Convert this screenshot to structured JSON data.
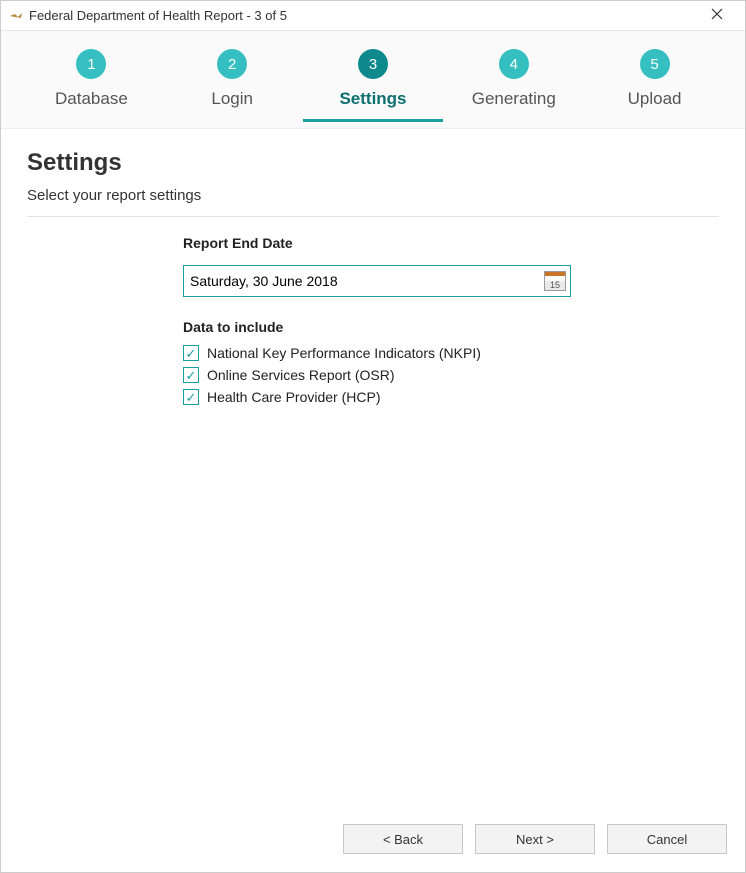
{
  "titlebar": {
    "text": "Federal Department of Health Report - 3 of 5"
  },
  "steps": [
    {
      "num": "1",
      "label": "Database"
    },
    {
      "num": "2",
      "label": "Login"
    },
    {
      "num": "3",
      "label": "Settings"
    },
    {
      "num": "4",
      "label": "Generating"
    },
    {
      "num": "5",
      "label": "Upload"
    }
  ],
  "page": {
    "title": "Settings",
    "subtitle": "Select your report settings"
  },
  "form": {
    "date_label": "Report End Date",
    "date_value": "Saturday, 30 June 2018",
    "cal_day": "15",
    "include_label": "Data to include",
    "options": [
      {
        "label": "National Key Performance Indicators (NKPI)",
        "checked": true
      },
      {
        "label": "Online Services Report (OSR)",
        "checked": true
      },
      {
        "label": "Health Care Provider (HCP)",
        "checked": true
      }
    ]
  },
  "footer": {
    "back": "< Back",
    "next": "Next >",
    "cancel": "Cancel"
  }
}
